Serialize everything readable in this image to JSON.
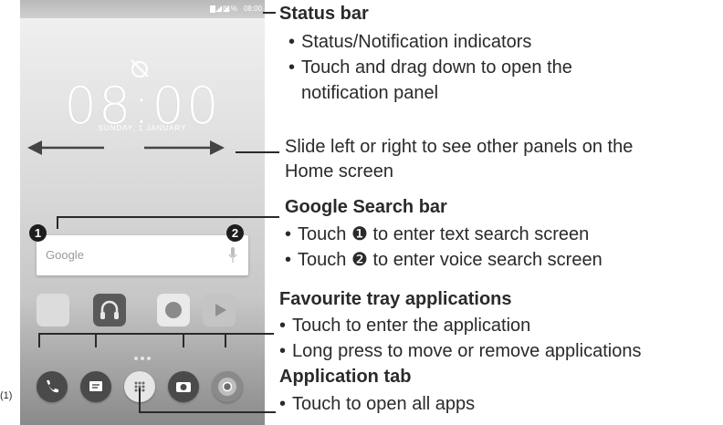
{
  "phone": {
    "clock": "08:00",
    "date": "SUNDAY, 1 JANUARY",
    "status_percent": "81%",
    "status_time": "08:00",
    "search_logo": "Google",
    "badge_1": "1",
    "badge_2": "2"
  },
  "figure_number": "(1)",
  "annotations": {
    "status_bar": {
      "heading": "Status bar",
      "bullets": [
        "Status/Notification indicators",
        "Touch and drag down to open the",
        "notification panel"
      ]
    },
    "slide": {
      "line1": "Slide left or right to see other panels on the",
      "line2": "Home screen"
    },
    "google_search": {
      "heading": "Google Search bar",
      "bullet1_pre": "Touch",
      "bullet1_marker": "❶",
      "bullet1_post": "to enter text search screen",
      "bullet2_pre": "Touch",
      "bullet2_marker": "❷",
      "bullet2_post": "to enter voice search screen"
    },
    "favourite_tray": {
      "heading": "Favourite tray applications",
      "bullets": [
        "Touch to enter the application",
        "Long press to move or remove applications"
      ]
    },
    "application_tab": {
      "heading": "Application tab",
      "bullets": [
        "Touch to open all apps"
      ]
    }
  }
}
